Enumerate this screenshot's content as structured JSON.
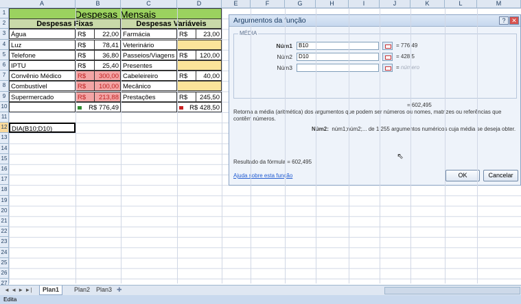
{
  "columns": [
    "A",
    "B",
    "C",
    "D",
    "E",
    "F",
    "G",
    "H",
    "I",
    "J",
    "K",
    "L",
    "M"
  ],
  "rows": [
    "1",
    "2",
    "3",
    "4",
    "5",
    "6",
    "7",
    "8",
    "9",
    "10",
    "11",
    "12",
    "13",
    "14",
    "15",
    "16",
    "17",
    "18",
    "19",
    "20",
    "21",
    "22",
    "23",
    "24",
    "25",
    "26",
    "27"
  ],
  "sheet": {
    "title": "Despesas Mensais",
    "fixas_header": "Despesas Fixas",
    "variaveis_header": "Despesas Variáveis",
    "currency": "R$",
    "fixas": [
      {
        "name": "Água",
        "value": "22,00"
      },
      {
        "name": "Luz",
        "value": "78,41"
      },
      {
        "name": "Telefone",
        "value": "36,80"
      },
      {
        "name": "IPTU",
        "value": "25,40"
      },
      {
        "name": "Convênio Médico",
        "value": "300,00"
      },
      {
        "name": "Combustível",
        "value": "100,00"
      },
      {
        "name": "Supermercado",
        "value": "213,88"
      }
    ],
    "variaveis": [
      {
        "name": "Farmácia",
        "value": "23,00"
      },
      {
        "name": "Veterinário",
        "value": ""
      },
      {
        "name": "Passeios/Viagens",
        "value": "120,00"
      },
      {
        "name": "Presentes",
        "value": ""
      },
      {
        "name": "Cabeleireiro",
        "value": "40,00"
      },
      {
        "name": "Mecânico",
        "value": ""
      },
      {
        "name": "Prestações",
        "value": "245,50"
      }
    ],
    "total_fixas": "R$ 776,49",
    "total_variaveis": "R$ 428,50",
    "editing_cell": "DIA(B10;D10)"
  },
  "dialog": {
    "title": "Argumentos da função",
    "help_glyph": "?",
    "close_glyph": "✕",
    "group_label": "MÉDIA",
    "args": [
      {
        "label": "Núm1",
        "input": "B10",
        "result": "776,49"
      },
      {
        "label": "Núm2",
        "input": "D10",
        "result": "428,5"
      },
      {
        "label": "Núm3",
        "input": "",
        "result": "número"
      }
    ],
    "eq": "=",
    "overall_result": "= 602,495",
    "description": "Retorna a média (aritmética) dos argumentos que podem ser números ou nomes, matrizes ou referências que contêm números.",
    "arg_help_label": "Núm2:",
    "arg_help_text": "núm1;núm2;... de 1 255 argumentos numéricos cuja média se deseja obter.",
    "formula_result": "Resultado da fórmula =  602,495",
    "help_link": "Ajuda sobre esta função",
    "ok": "OK",
    "cancel": "Cancelar"
  },
  "tabs": {
    "nav": "◄ ◄ ► ►|",
    "items": [
      "Plan1",
      "Plan2",
      "Plan3"
    ]
  },
  "status": "Edita"
}
